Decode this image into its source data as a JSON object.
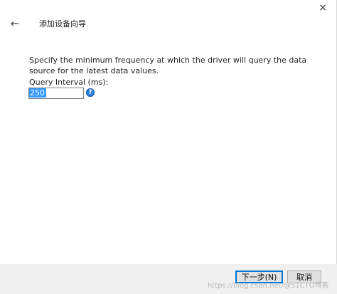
{
  "window": {
    "close_glyph": "×",
    "back_glyph": "←",
    "title": "添加设备向导"
  },
  "content": {
    "description": "Specify the minimum frequency at which the driver will query the data source for the latest data values.",
    "interval_label": "Query Interval (ms):",
    "interval_value": "250",
    "help_glyph": "?"
  },
  "footer": {
    "next_label": "下一步(N)",
    "cancel_label": "取消"
  },
  "watermark": "https://blog.csdn.net/@51CTO博客",
  "colors": {
    "accent": "#0078d7",
    "selection": "#3399ff",
    "help_icon": "#2a7fd8",
    "footer_bg": "#f0f0f0"
  },
  "icons": {
    "back": "arrow-left-icon",
    "close": "close-icon",
    "help": "help-icon"
  }
}
